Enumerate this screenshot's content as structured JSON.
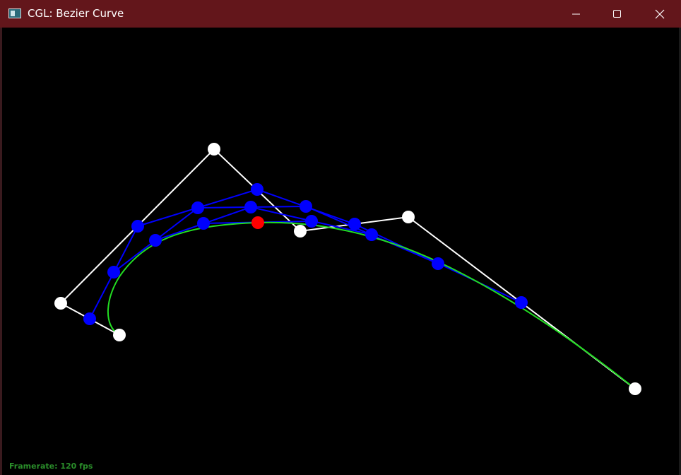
{
  "window": {
    "title": "CGL: Bezier Curve",
    "background": "#000000",
    "titlebar_color": "#63161b",
    "controls": [
      "minimize",
      "maximize",
      "close"
    ]
  },
  "status": {
    "framerate": "Framerate: 120 fps"
  },
  "colors": {
    "control_polygon": "#ffffff",
    "intermediate": "#0000ff",
    "evaluated_point": "#ff0000",
    "curve": "#00dd00",
    "framerate_text": "#2a8d2a"
  }
}
